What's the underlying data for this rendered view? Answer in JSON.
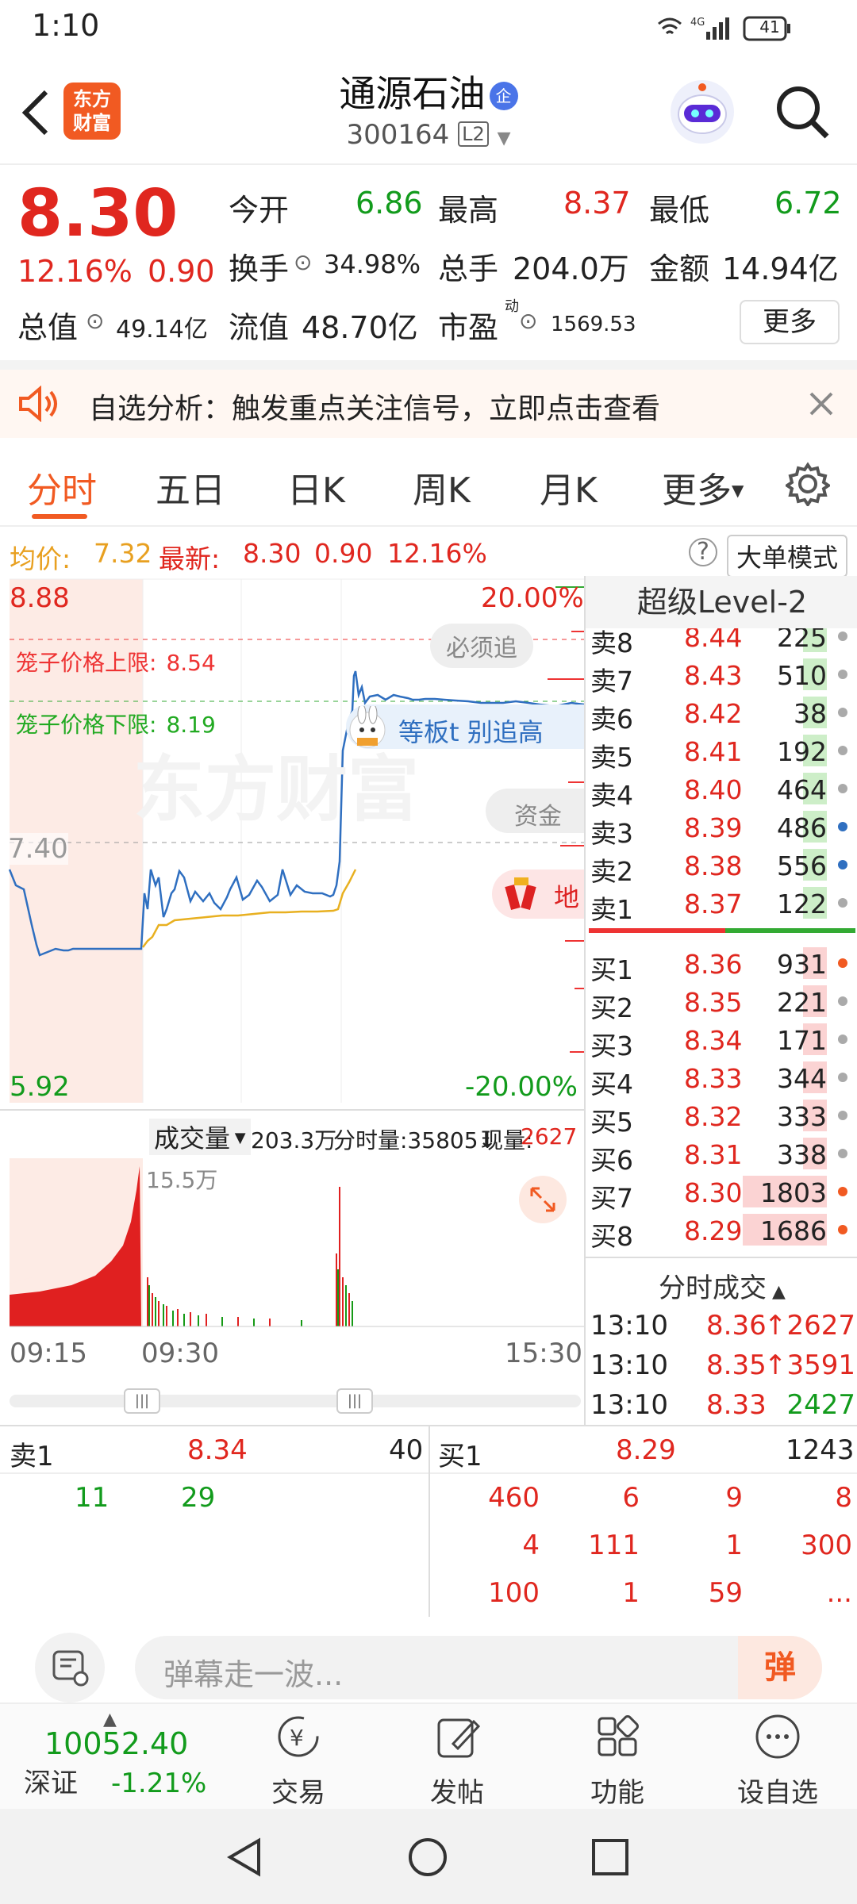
{
  "status": {
    "time": "1:10",
    "battery": "41"
  },
  "header": {
    "brand": "东方\n财富",
    "name": "通源石油",
    "badge": "企",
    "code": "300164",
    "level": "L2"
  },
  "quote": {
    "price": "8.30",
    "pct": "12.16%",
    "chg": "0.90",
    "open_l": "今开",
    "open_v": "6.86",
    "high_l": "最高",
    "high_v": "8.37",
    "low_l": "最低",
    "low_v": "6.72",
    "turn_l": "换手",
    "turn_v": "34.98%",
    "vol_l": "总手",
    "vol_v": "204.0万",
    "amt_l": "金额",
    "amt_v": "14.94亿",
    "mcap_l": "总值",
    "mcap_v": "49.14亿",
    "float_l": "流值",
    "float_v": "48.70亿",
    "pe_l": "市盈",
    "pe_sup": "动",
    "pe_v": "1569.53",
    "more": "更多"
  },
  "alert": {
    "text": "自选分析：触发重点关注信号，立即点击查看"
  },
  "tabs": [
    "分时",
    "五日",
    "日K",
    "周K",
    "月K",
    "更多"
  ],
  "avg": {
    "label": "均价:",
    "value": "7.32",
    "latest_label": "最新:",
    "latest": "8.30",
    "chg": "0.90",
    "pct": "12.16%",
    "mode": "大单模式"
  },
  "chart_labels": {
    "ymax": "8.88",
    "ymid": "7.40",
    "ymin": "5.92",
    "pmax": "20.00%",
    "pmin": "-20.00%",
    "cage_up": "笼子价格上限:",
    "cage_up_v": "8.54",
    "cage_dn": "笼子价格下限:",
    "cage_dn_v": "8.19",
    "must": "必须追",
    "zhuiban": "等板t  别追高",
    "zijin": "资金",
    "di": "地",
    "watermark": "东方财富",
    "vol_menu": "成交量",
    "vol_total": "203.3万",
    "vol_min": "分时量:35805↓",
    "vol_now_l": "现量:",
    "vol_now": "2627",
    "vol_max": "15.5万",
    "t1": "09:15",
    "t2": "09:30",
    "t3": "15:30"
  },
  "level2": {
    "title": "超级Level-2",
    "asks": [
      {
        "l": "卖8",
        "p": "8.44",
        "v": "225"
      },
      {
        "l": "卖7",
        "p": "8.43",
        "v": "510"
      },
      {
        "l": "卖6",
        "p": "8.42",
        "v": "38"
      },
      {
        "l": "卖5",
        "p": "8.41",
        "v": "192"
      },
      {
        "l": "卖4",
        "p": "8.40",
        "v": "464"
      },
      {
        "l": "卖3",
        "p": "8.39",
        "v": "486"
      },
      {
        "l": "卖2",
        "p": "8.38",
        "v": "556"
      },
      {
        "l": "卖1",
        "p": "8.37",
        "v": "122"
      }
    ],
    "bids": [
      {
        "l": "买1",
        "p": "8.36",
        "v": "931"
      },
      {
        "l": "买2",
        "p": "8.35",
        "v": "221"
      },
      {
        "l": "买3",
        "p": "8.34",
        "v": "171"
      },
      {
        "l": "买4",
        "p": "8.33",
        "v": "344"
      },
      {
        "l": "买5",
        "p": "8.32",
        "v": "333"
      },
      {
        "l": "买6",
        "p": "8.31",
        "v": "338"
      },
      {
        "l": "买7",
        "p": "8.30",
        "v": "1803"
      },
      {
        "l": "买8",
        "p": "8.29",
        "v": "1686"
      }
    ],
    "trades_title": "分时成交",
    "trades": [
      {
        "t": "13:10",
        "p": "8.36",
        "v": "↑2627"
      },
      {
        "t": "13:10",
        "p": "8.35",
        "v": "↑3591"
      },
      {
        "t": "13:10",
        "p": "8.33",
        "v": "2427"
      }
    ]
  },
  "queue": {
    "sell_l": "卖1",
    "sell_p": "8.34",
    "sell_n": "40",
    "sell_q": [
      "11",
      "29"
    ],
    "buy_l": "买1",
    "buy_p": "8.29",
    "buy_n": "1243",
    "buy_q": [
      "460",
      "6",
      "9",
      "8",
      "4",
      "111",
      "1",
      "300",
      "100",
      "1",
      "59",
      "..."
    ]
  },
  "danmu": {
    "placeholder": "弹幕走一波...",
    "btn": "弹"
  },
  "bottomnav": {
    "index_v": "10052.40",
    "index_n": "深证",
    "index_pct": "-1.21%",
    "items": [
      "交易",
      "发帖",
      "功能",
      "设自选"
    ]
  }
}
